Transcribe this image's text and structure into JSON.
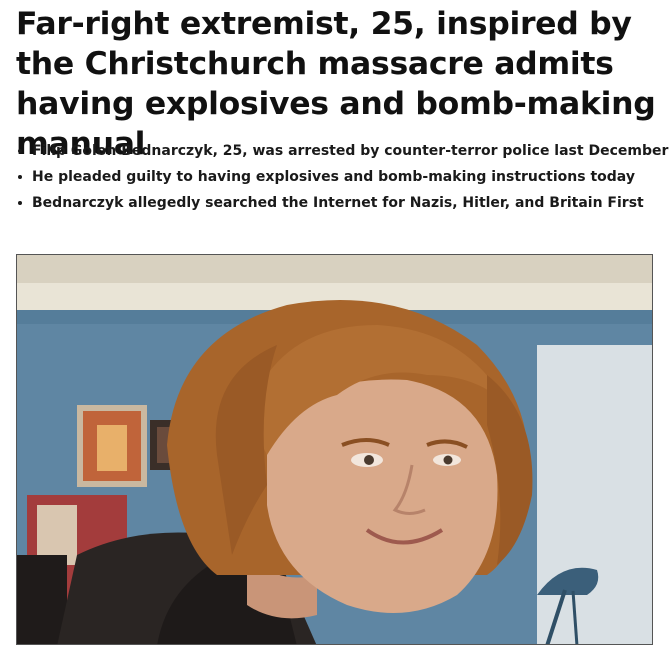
{
  "article": {
    "headline": "Far-right extremist, 25, inspired by the Christchurch massacre admits having explosives and bomb-making manual",
    "bullets": [
      "Filip Golon Bednarczyk, 25, was arrested by counter-terror police last December",
      "He pleaded guilty to having explosives and bomb-making instructions today",
      "Bednarczyk allegedly searched the Internet for Nazis, Hitler, and Britain First"
    ]
  },
  "photo": {
    "subject": "young man with shoulder-length ginger-brown hair smiling, dark hooded top, bedroom wall with posters and desk lamp"
  },
  "colors": {
    "text": "#111111",
    "wall": "#5f86a3",
    "ceiling": "#e9e4d6",
    "hair": "#a8652b",
    "skin": "#d9a98a",
    "hoodie": "#2a2523"
  }
}
